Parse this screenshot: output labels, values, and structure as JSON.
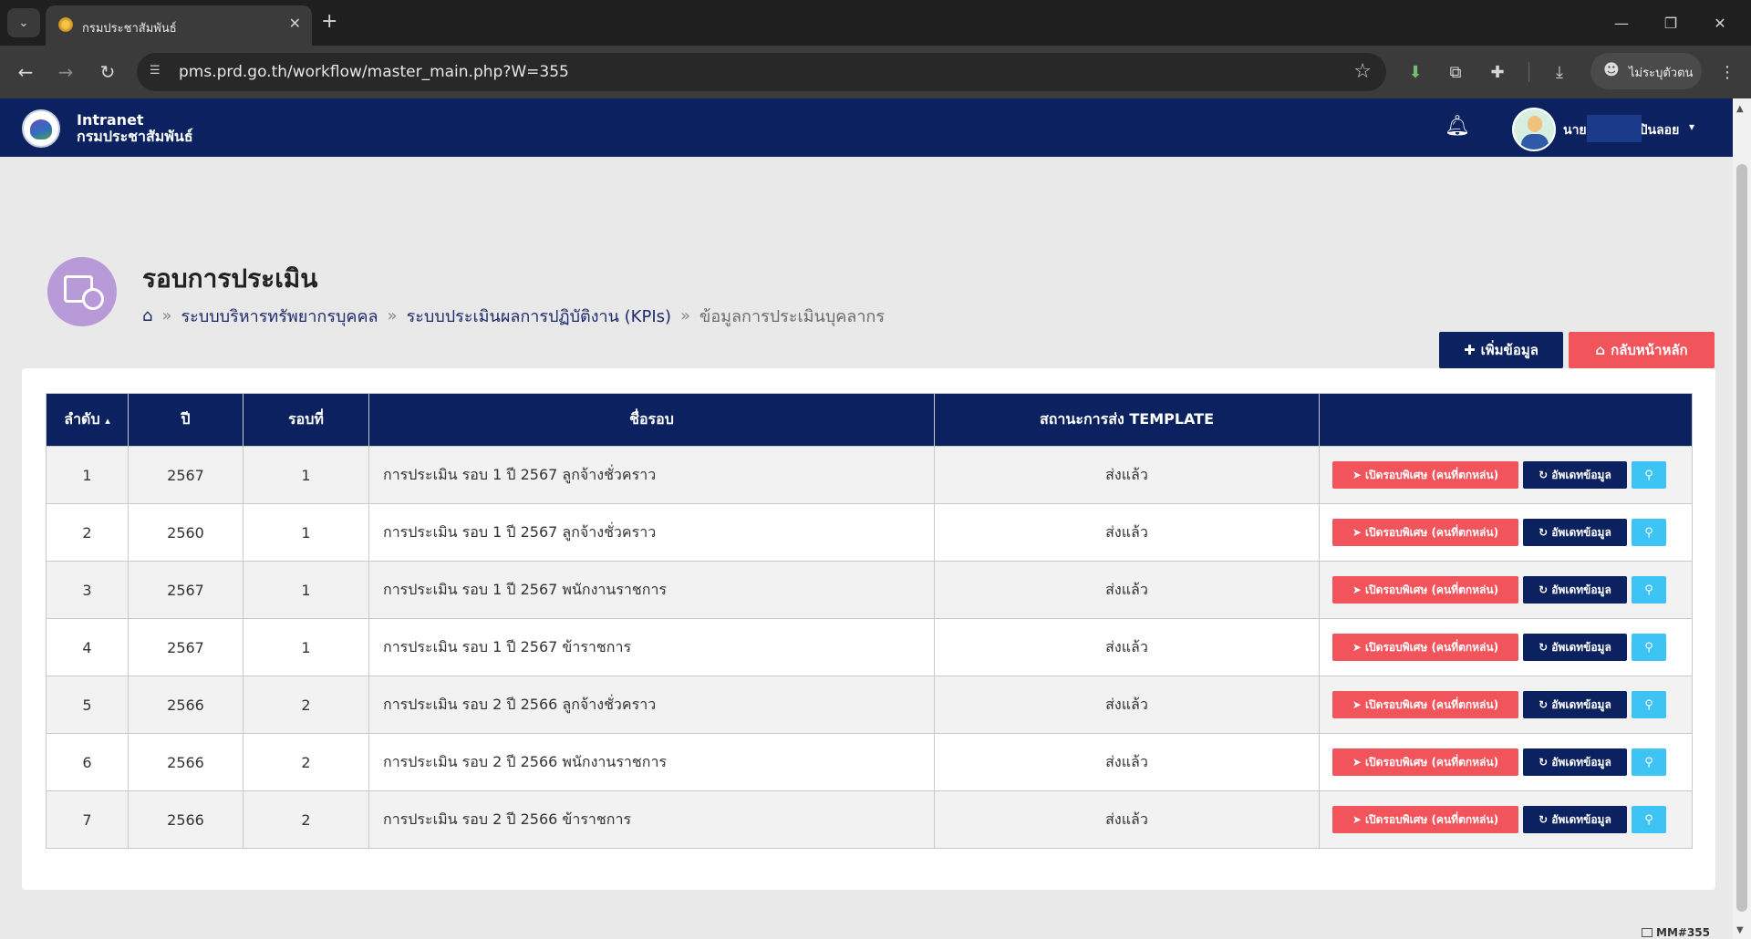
{
  "browser": {
    "tab_title": "กรมประชาสัมพันธ์",
    "url": "pms.prd.go.th/workflow/master_main.php?W=355",
    "profile_label": "ไม่ระบุตัวตน"
  },
  "header": {
    "brand_line1": "Intranet",
    "brand_line2": "กรมประชาสัมพันธ์",
    "user_prefix": "นาย",
    "user_suffix": "ปินลอย"
  },
  "page": {
    "title": "รอบการประเมิน",
    "breadcrumb": [
      "ระบบบริหารทรัพยากรบุคคล",
      "ระบบประเมินผลการปฏิบัติงาน (KPIs)",
      "ข้อมูลการประเมินบุคลากร"
    ],
    "add_button": "เพิ่มข้อมูล",
    "home_button": "กลับหน้าหลัก"
  },
  "table": {
    "columns": [
      "ลำดับ",
      "ปี",
      "รอบที่",
      "ชื่อรอบ",
      "สถานะการส่ง TEMPLATE",
      ""
    ],
    "sort_indicator": "▴",
    "open_label": "เปิดรอบพิเศษ (คนที่ตกหล่น)",
    "update_label": "อัพเดทข้อมูล",
    "rows": [
      {
        "no": "1",
        "year": "2567",
        "round": "1",
        "name": "การประเมิน รอบ 1 ปี 2567 ลูกจ้างชั่วคราว",
        "status": "ส่งแล้ว"
      },
      {
        "no": "2",
        "year": "2560",
        "round": "1",
        "name": "การประเมิน รอบ 1 ปี 2567 ลูกจ้างชั่วคราว",
        "status": "ส่งแล้ว"
      },
      {
        "no": "3",
        "year": "2567",
        "round": "1",
        "name": "การประเมิน รอบ 1 ปี 2567 พนักงานราชการ",
        "status": "ส่งแล้ว"
      },
      {
        "no": "4",
        "year": "2567",
        "round": "1",
        "name": "การประเมิน รอบ 1 ปี 2567 ข้าราชการ",
        "status": "ส่งแล้ว"
      },
      {
        "no": "5",
        "year": "2566",
        "round": "2",
        "name": "การประเมิน รอบ 2 ปี 2566 ลูกจ้างชั่วคราว",
        "status": "ส่งแล้ว"
      },
      {
        "no": "6",
        "year": "2566",
        "round": "2",
        "name": "การประเมิน รอบ 2 ปี 2566 พนักงานราชการ",
        "status": "ส่งแล้ว"
      },
      {
        "no": "7",
        "year": "2566",
        "round": "2",
        "name": "การประเมิน รอบ 2 ปี 2566 ข้าราชการ",
        "status": "ส่งแล้ว"
      }
    ]
  },
  "footer": {
    "code": "MM#355"
  },
  "colors": {
    "navy": "#0b2160",
    "red": "#f2545b",
    "cyan": "#3ec3f5",
    "page_icon": "#b99ad9"
  }
}
